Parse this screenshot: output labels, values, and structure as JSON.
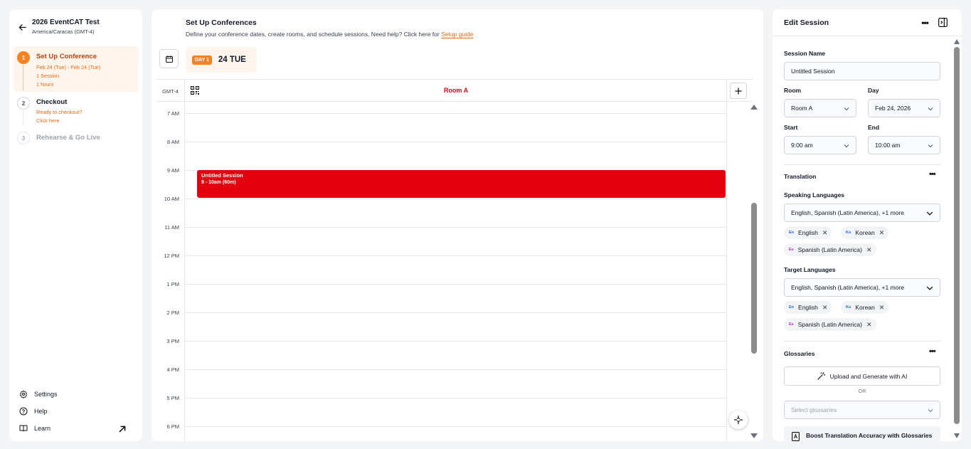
{
  "event": {
    "name": "2026 EventCAT Test",
    "timezone": "America/Caracas (GMT-4)"
  },
  "steps": [
    {
      "num": "1",
      "label": "Set Up Conference",
      "lines": [
        "Feb 24 (Tue) - Feb 24 (Tue)",
        "1 Session",
        "1 hours"
      ]
    },
    {
      "num": "2",
      "label": "Checkout",
      "lines": [
        "Ready to checkout?",
        "Click here"
      ]
    },
    {
      "num": "3",
      "label": "Rehearse & Go Live"
    }
  ],
  "sidebar_footer": {
    "settings": "Settings",
    "help": "Help",
    "learn": "Learn"
  },
  "setup": {
    "title": "Set Up Conferences",
    "description": "Define your conference dates, create rooms, and schedule sessions. Need help? Click here for",
    "guide_link": "Setup guide"
  },
  "day_tab": {
    "badge": "DAY 1",
    "label": "24 TUE"
  },
  "grid": {
    "timezone": "GMT-4",
    "room": "Room A",
    "hours": [
      "7 AM",
      "8 AM",
      "9 AM",
      "10 AM",
      "11 AM",
      "12 PM",
      "1 PM",
      "2 PM",
      "3 PM",
      "4 PM",
      "5 PM",
      "6 PM"
    ]
  },
  "session_block": {
    "title": "Untitled Session",
    "time": "9 - 10am (60m)",
    "color": "#e3000f"
  },
  "edit_session": {
    "title": "Edit Session",
    "session_name_label": "Session Name",
    "session_name_value": "Untitled Session",
    "room_label": "Room",
    "room_value": "Room A",
    "day_label": "Day",
    "day_value": "Feb 24, 2026",
    "start_label": "Start",
    "start_value": "9:00 am",
    "end_label": "End",
    "end_value": "10:00 am",
    "translation_label": "Translation",
    "speaking_label": "Speaking Languages",
    "speaking_value": "English, Spanish (Latin America), +1 more",
    "speaking_chips": [
      {
        "code": "En",
        "label": "English"
      },
      {
        "code": "Ko",
        "label": "Korean"
      },
      {
        "code": "Es",
        "label": "Spanish (Latin America)"
      }
    ],
    "target_label": "Target Languages",
    "target_value": "English, Spanish (Latin America), +1 more",
    "target_chips": [
      {
        "code": "En",
        "label": "English"
      },
      {
        "code": "Ko",
        "label": "Korean"
      },
      {
        "code": "Es",
        "label": "Spanish (Latin America)"
      }
    ],
    "glossaries_label": "Glossaries",
    "upload_button": "Upload and Generate with AI",
    "or_text": "OR",
    "select_placeholder": "Select glossaries",
    "promo_text": "Boost Translation Accuracy with Glossaries"
  },
  "colors": {
    "accent": "#f58220",
    "room_text": "#d9001b",
    "session": "#e3000f"
  },
  "icons": [
    "back-arrow-icon",
    "calendar-icon",
    "qr-code-icon",
    "plus-icon",
    "gear-icon",
    "help-circle-icon",
    "book-icon",
    "external-link-icon",
    "more-icon",
    "collapse-panel-icon",
    "chevron-down-icon",
    "close-icon",
    "magic-wand-icon",
    "glossary-icon",
    "focus-icon"
  ]
}
